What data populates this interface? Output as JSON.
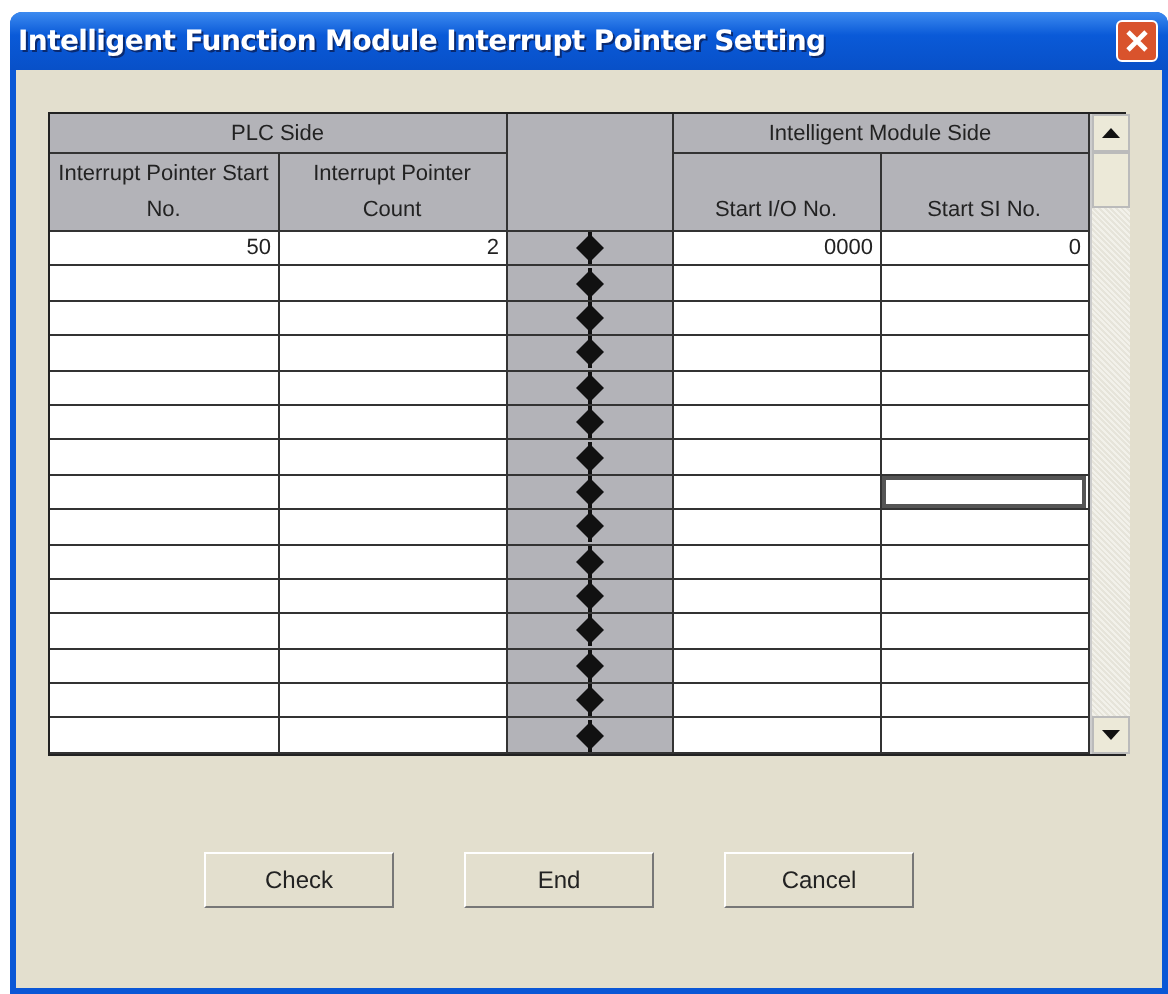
{
  "window": {
    "title": "Intelligent Function Module Interrupt Pointer Setting"
  },
  "table": {
    "groups": [
      {
        "label": "PLC Side"
      },
      {
        "label": "Intelligent Module Side"
      }
    ],
    "columns": [
      {
        "label": "Interrupt Pointer Start No."
      },
      {
        "label": "Interrupt Pointer Count"
      },
      {
        "label": "Start I/O No."
      },
      {
        "label": "Start SI No."
      }
    ],
    "rows": [
      {
        "cells": [
          "50",
          "2",
          "0000",
          "0"
        ],
        "selected": false
      },
      {
        "selected": false
      },
      {
        "selected": false
      },
      {
        "selected": false
      },
      {
        "selected": false
      },
      {
        "selected": false
      },
      {
        "selected": false
      },
      {
        "selected": true
      },
      {
        "selected": false
      },
      {
        "selected": false
      },
      {
        "selected": false
      },
      {
        "selected": false
      },
      {
        "selected": false
      },
      {
        "selected": false
      },
      {
        "selected": false
      }
    ]
  },
  "buttons": [
    {
      "label": "Check"
    },
    {
      "label": "End"
    },
    {
      "label": "Cancel"
    }
  ]
}
